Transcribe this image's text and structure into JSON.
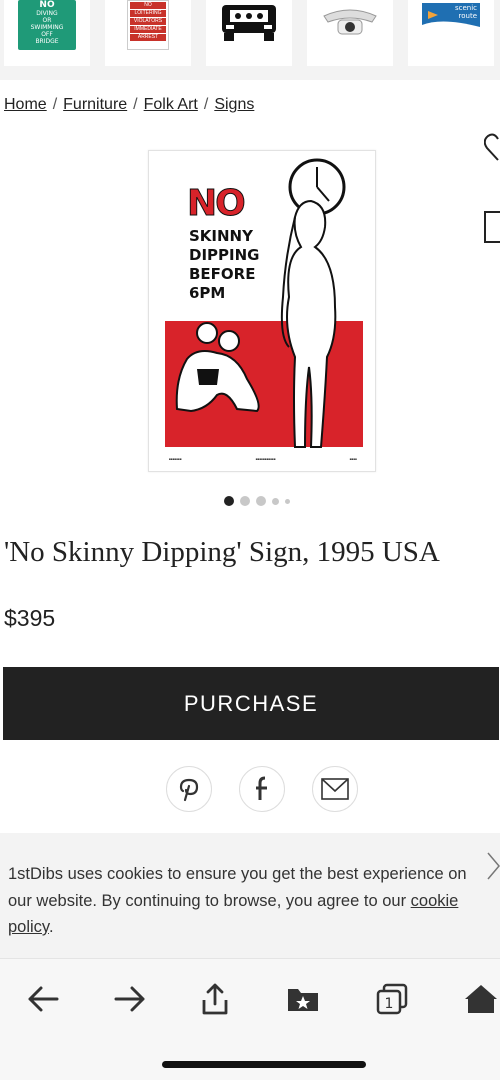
{
  "thumbnails": {
    "items": [
      {
        "name": "no-diving-sign",
        "lines": [
          "NO",
          "DIVING",
          "OR",
          "SWIMMING",
          "OFF",
          "BRIDGE"
        ]
      },
      {
        "name": "no-loitering-sign",
        "lines": [
          "NO",
          "LOITERING",
          "VIOLATORS",
          "IMMEDIATE",
          "ARREST"
        ]
      },
      {
        "name": "vintage-car-sign",
        "lines": []
      },
      {
        "name": "telephone-sign",
        "lines": []
      },
      {
        "name": "scenic-route-sign",
        "lines": [
          "scenic",
          "route"
        ]
      }
    ]
  },
  "breadcrumb": {
    "items": [
      "Home",
      "Furniture",
      "Folk Art",
      "Signs"
    ],
    "separator": "/"
  },
  "product": {
    "image": {
      "headline": "NO",
      "lines": [
        "SKINNY",
        "DIPPING",
        "BEFORE",
        "6PM"
      ],
      "accent_color": "#d8232a"
    },
    "carousel": {
      "count": 5,
      "active_index": 0
    },
    "title": "'No Skinny Dipping' Sign, 1995 USA",
    "price": "$395"
  },
  "actions": {
    "purchase_label": "PURCHASE",
    "share": [
      "pinterest-icon",
      "facebook-icon",
      "mail-icon"
    ]
  },
  "cookie_banner": {
    "text": "1stDibs uses cookies to ensure you get the best experience on our website. By continuing to browse, you agree to our ",
    "link_text": "cookie policy",
    "suffix": "."
  },
  "browser_toolbar": {
    "icons": [
      "back-arrow-icon",
      "forward-arrow-icon",
      "share-icon",
      "bookmarks-icon",
      "tabs-icon",
      "home-icon"
    ],
    "tab_count": "1"
  }
}
